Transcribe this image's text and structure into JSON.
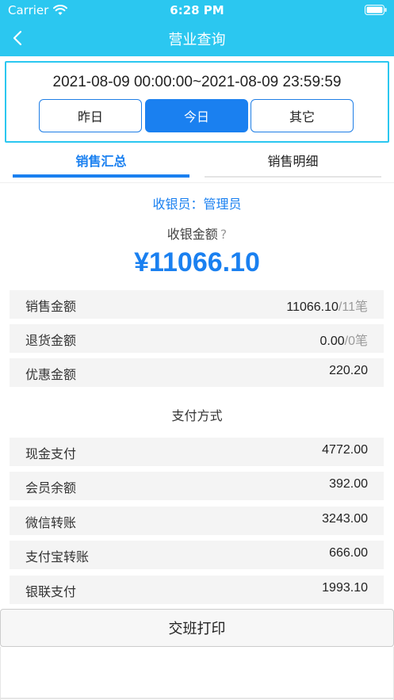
{
  "status_bar": {
    "carrier": "Carrier",
    "time": "6:28 PM"
  },
  "nav": {
    "title": "营业查询",
    "back_icon": "chevron-left-icon"
  },
  "date_filter": {
    "range": "2021-08-09 00:00:00~2021-08-09 23:59:59",
    "buttons": [
      "昨日",
      "今日",
      "其它"
    ],
    "selected": "今日"
  },
  "tabs": [
    {
      "label": "销售汇总",
      "active": true
    },
    {
      "label": "销售明细",
      "active": false
    }
  ],
  "summary": {
    "cashier_label": "收银员：",
    "cashier_name": "管理员",
    "amount_label": "收银金额",
    "help_icon": "?",
    "total_amount": "¥11066.10"
  },
  "sales_rows": [
    {
      "label": "销售金额",
      "value": "11066.10",
      "sep": "/",
      "count": "11笔"
    },
    {
      "label": "退货金额",
      "value": "0.00",
      "sep": "/",
      "count": "0笔"
    },
    {
      "label": "优惠金额",
      "value": "220.20"
    }
  ],
  "payment": {
    "title": "支付方式",
    "rows": [
      {
        "label": "现金支付",
        "value": "4772.00"
      },
      {
        "label": "会员余额",
        "value": "392.00"
      },
      {
        "label": "微信转账",
        "value": "3243.00"
      },
      {
        "label": "支付宝转账",
        "value": "666.00"
      },
      {
        "label": "银联支付",
        "value": "1993.10"
      }
    ]
  },
  "print_button": "交班打印",
  "colors": {
    "header": "#2bc7f0",
    "accent": "#1a80f0",
    "row_bg": "#f4f4f4"
  }
}
